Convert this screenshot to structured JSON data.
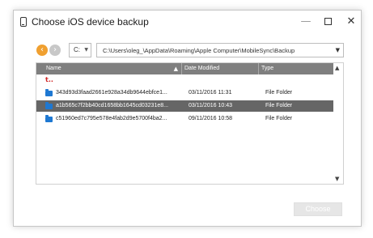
{
  "window": {
    "title": "Choose iOS device backup",
    "minimize_glyph": "—",
    "close_glyph": "✕"
  },
  "nav": {
    "back_glyph": "‹",
    "forward_glyph": "›"
  },
  "drive": {
    "value": "C:"
  },
  "path": {
    "value": "C:\\Users\\oleg_\\AppData\\Roaming\\Apple Computer\\MobileSync\\Backup"
  },
  "table": {
    "headers": {
      "name": "Name",
      "date": "Date Modified",
      "type": "Type"
    },
    "up_glyph": "t..",
    "rows": [
      {
        "name": "343d93d3faad2661e928a34db9644ebfce1...",
        "date": "03/11/2016 11:31",
        "type": "File Folder"
      },
      {
        "name": "a1b565c7f2bb40cd1658bb1645cd03231e8...",
        "date": "03/11/2016 10:43",
        "type": "File Folder"
      },
      {
        "name": "c51960ed7c795e578e4fab2d9e5700f4ba2...",
        "date": "09/11/2016 10:58",
        "type": "File Folder"
      }
    ],
    "selected_row": 1
  },
  "footer": {
    "choose_label": "Choose"
  },
  "colors": {
    "accent": "#f0a030",
    "header_bg": "#7f7f7f",
    "selected_bg": "#666666",
    "folder": "#1e78d2"
  }
}
